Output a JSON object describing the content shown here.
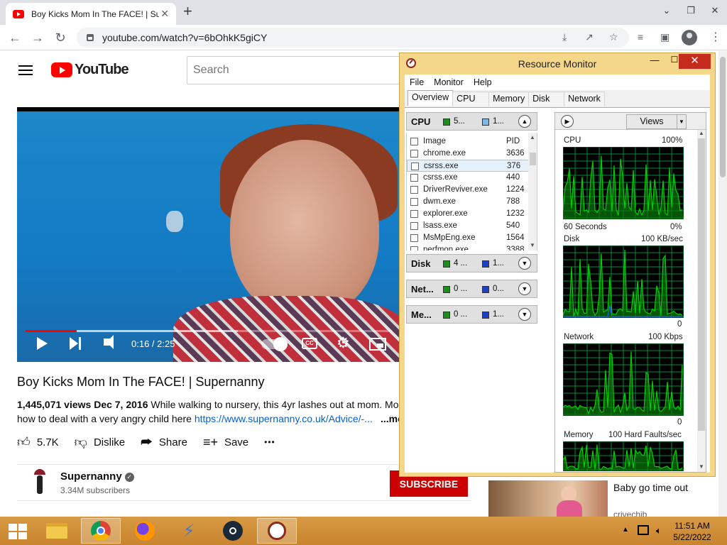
{
  "browser": {
    "tab_title": "Boy Kicks Mom In The FACE! | Supernanny - YouTube",
    "tab_close": "✕",
    "new_tab": "+",
    "url": "youtube.com/watch?v=6bOhkK5giCY",
    "window_controls": {
      "minimize": "⌄",
      "restore": "❐",
      "close": "✕"
    },
    "nav": {
      "back": "←",
      "forward": "→",
      "reload": "↻"
    },
    "toolbar_icons": {
      "install": "⤓",
      "share": "↗",
      "bookmark": "☆",
      "media": "≡",
      "sidepanel": "▣"
    }
  },
  "youtube": {
    "logo_text": "YouTube",
    "search_placeholder": "Search",
    "player": {
      "time_current": "0:16",
      "time_total": "2:25",
      "time_display": "0:16 / 2:25",
      "progress": 0.1395,
      "cc_label": "CC",
      "settings_glyph": "⚙"
    },
    "video": {
      "title": "Boy Kicks Mom In The FACE! | Supernanny",
      "views": "1,445,071 views",
      "date": "Dec 7, 2016",
      "description_line1": "While walking to nursery, this 4yr lashes out at mom. Mo",
      "description_line2_prefix": "how to deal with a very angry child here ",
      "description_link": "https://www.supernanny.co.uk/Advice/-...",
      "more": "...more"
    },
    "actions": {
      "like_count": "5.7K",
      "dislike": "Dislike",
      "share": "Share",
      "save": "Save",
      "more": "•••"
    },
    "channel": {
      "name": "Supernanny",
      "verified_glyph": "✓",
      "subscribers": "3.34M subscribers",
      "subscribe_label": "SUBSCRIBE"
    },
    "recommended": {
      "title": "Baby go time out",
      "channel": "crivechib"
    }
  },
  "resource_monitor": {
    "title": "Resource Monitor",
    "title_controls": {
      "minimize": "—",
      "maximize": "☐",
      "close": "✕"
    },
    "menu": [
      "File",
      "Monitor",
      "Help"
    ],
    "tabs": [
      "Overview",
      "CPU",
      "Memory",
      "Disk",
      "Network"
    ],
    "active_tab": "Overview",
    "cpu_section": {
      "label": "CPU",
      "value1": "5...",
      "value2": "1...",
      "chevron": "▲",
      "columns": {
        "image": "Image",
        "pid": "PID"
      },
      "processes": [
        {
          "name": "chrome.exe",
          "pid": "3636"
        },
        {
          "name": "csrss.exe",
          "pid": "376"
        },
        {
          "name": "csrss.exe",
          "pid": "440"
        },
        {
          "name": "DriverReviver.exe",
          "pid": "1224"
        },
        {
          "name": "dwm.exe",
          "pid": "788"
        },
        {
          "name": "explorer.exe",
          "pid": "1232"
        },
        {
          "name": "lsass.exe",
          "pid": "540"
        },
        {
          "name": "MsMpEng.exe",
          "pid": "1564"
        },
        {
          "name": "perfmon.exe",
          "pid": "3388"
        }
      ],
      "selected_index": 1
    },
    "disk_section": {
      "label": "Disk",
      "value1": "4 ...",
      "value2": "1...",
      "chevron": "▼"
    },
    "network_section": {
      "label": "Net...",
      "value1": "0 ...",
      "value2": "0...",
      "chevron": "▼"
    },
    "memory_section": {
      "label": "Me...",
      "value1": "0 ...",
      "value2": "1...",
      "chevron": "▼"
    },
    "views_button": "Views",
    "views_dropdown": "▼",
    "expand_glyph": "▶",
    "graphs": {
      "cpu": {
        "label": "CPU",
        "max": "100%",
        "footer_left": "60 Seconds",
        "footer_right": "0%"
      },
      "disk": {
        "label": "Disk",
        "max": "100 KB/sec",
        "min": "0"
      },
      "network": {
        "label": "Network",
        "max": "100 Kbps",
        "min": "0"
      },
      "memory": {
        "label": "Memory",
        "max": "100 Hard Faults/sec"
      }
    },
    "colors": {
      "graph_line": "#00d000",
      "graph_fill": "#0a7a0a",
      "graph_grid": "#008a3a",
      "disk_blue": "#2060ff"
    }
  },
  "taskbar": {
    "apps": [
      "file-explorer",
      "chrome",
      "firefox",
      "winamp",
      "steam",
      "resource-monitor"
    ],
    "tray_up": "▲",
    "time": "11:51 AM",
    "date": "5/22/2022"
  }
}
